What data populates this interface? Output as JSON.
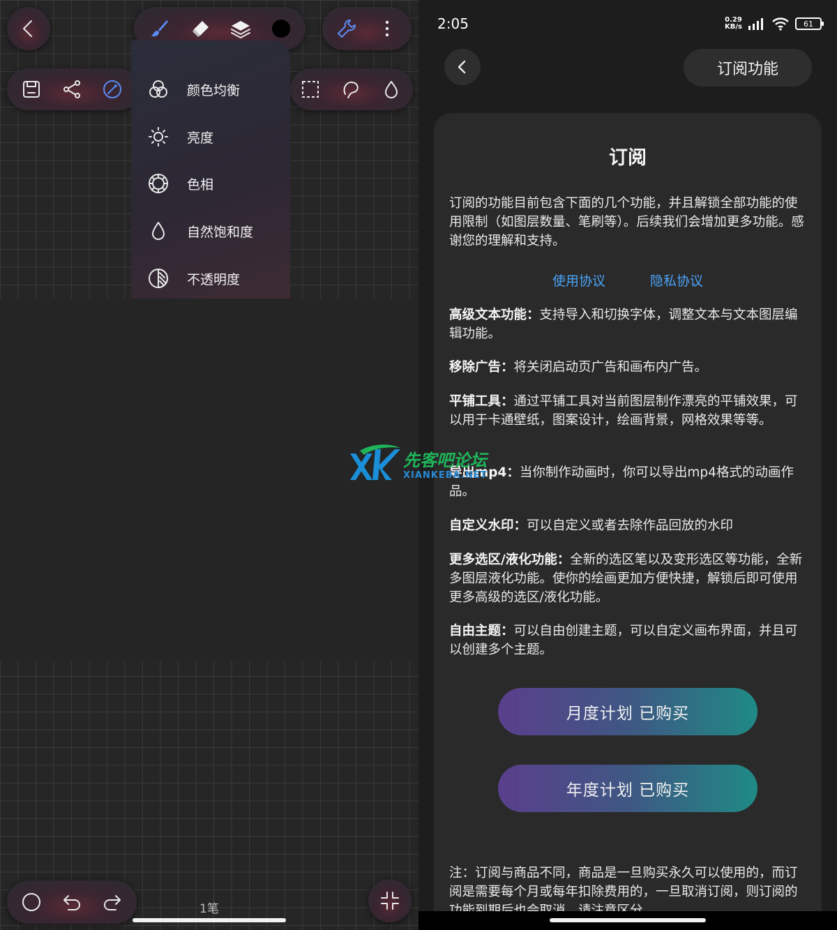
{
  "left_panel": {
    "dropdown": {
      "items": [
        {
          "label": "颜色均衡",
          "icon": "color-balance-icon"
        },
        {
          "label": "亮度",
          "icon": "brightness-icon"
        },
        {
          "label": "色相",
          "icon": "hue-icon"
        },
        {
          "label": "自然饱和度",
          "icon": "saturation-icon"
        },
        {
          "label": "不透明度",
          "icon": "opacity-icon"
        }
      ]
    },
    "stroke_count": "1笔",
    "colors": {
      "accent_start": "#8a5cf6",
      "accent_end": "#43d3c4",
      "active_icon": "#5b8cf5"
    }
  },
  "right_panel": {
    "status": {
      "time": "2:05",
      "net_speed_value": "0.29",
      "net_speed_unit": "KB/s",
      "battery": "61"
    },
    "header": {
      "subscription_button": "订阅功能"
    },
    "card": {
      "title": "订阅",
      "intro": "订阅的功能目前包含下面的几个功能，并且解锁全部功能的使用限制（如图层数量、笔刷等）。后续我们会增加更多功能。感谢您的理解和支持。",
      "links": {
        "terms": "使用协议",
        "privacy": "隐私协议"
      },
      "features": [
        {
          "name": "高级文本功能：",
          "desc": "支持导入和切换字体，调整文本与文本图层编辑功能。"
        },
        {
          "name": "移除广告：",
          "desc": "将关闭启动页广告和画布内广告。"
        },
        {
          "name": "平铺工具：",
          "desc": "通过平铺工具对当前图层制作漂亮的平铺效果，可以用于卡通壁纸，图案设计，绘画背景，网格效果等等。"
        },
        {
          "name": "导出mp4：",
          "desc": "当你制作动画时，你可以导出mp4格式的动画作品。"
        },
        {
          "name": "自定义水印：",
          "desc": "可以自定义或者去除作品回放的水印"
        },
        {
          "name": "更多选区/液化功能：",
          "desc": "全新的选区笔以及变形选区等功能，全新多图层液化功能。使你的绘画更加方便快捷，解锁后即可使用更多高级的选区/液化功能。"
        },
        {
          "name": "自由主题：",
          "desc": "可以自由创建主题，可以自定义画布界面，并且可以创建多个主题。"
        }
      ],
      "plans": {
        "monthly": "月度计划 已购买",
        "yearly": "年度计划 已购买"
      },
      "note": "注：订阅与商品不同，商品是一旦购买永久可以使用的，而订阅是需要每个月或每年扣除费用的，一旦取消订阅，则订阅的功能到期后也会取消，请注意区分。"
    },
    "colors": {
      "link": "#4aa3f5",
      "plan_start": "#5a3f8c",
      "plan_end": "#1f8a85"
    }
  },
  "watermark": {
    "cn": "先客吧论坛",
    "en": "XIANKEBA.NET"
  }
}
